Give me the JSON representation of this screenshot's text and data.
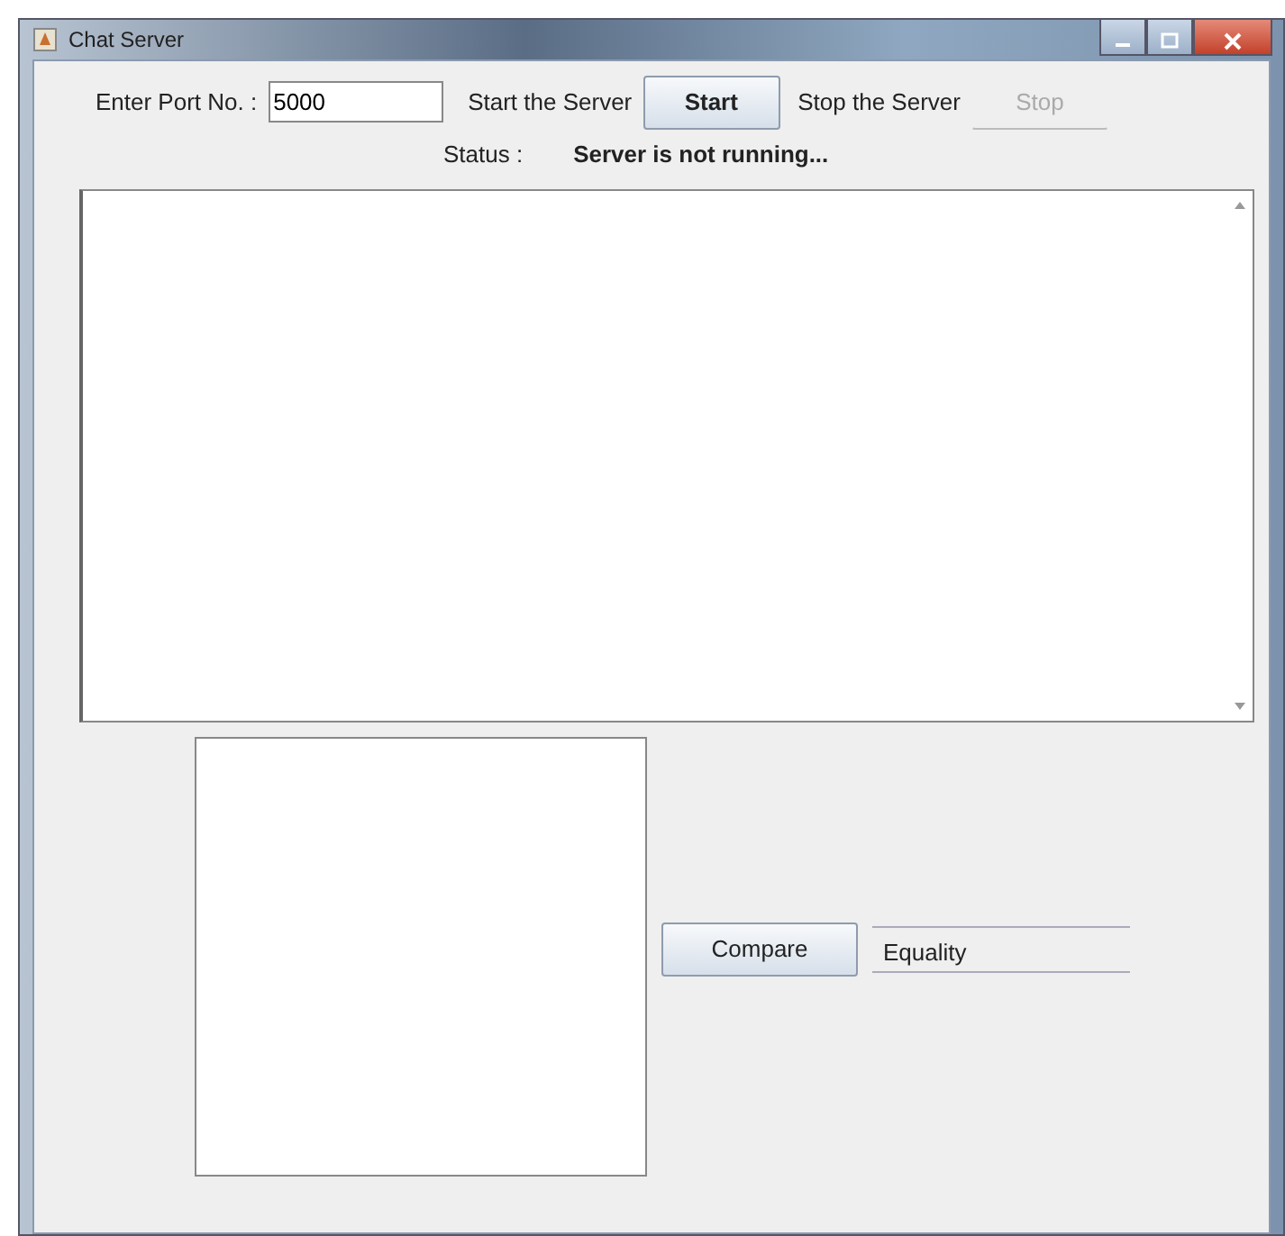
{
  "window": {
    "title": "Chat Server"
  },
  "port": {
    "label": "Enter Port No. :",
    "value": "5000"
  },
  "start": {
    "label": "Start the Server",
    "button": "Start",
    "disabled": false
  },
  "stop": {
    "label": "Stop the Server",
    "button": "Stop",
    "disabled": true
  },
  "status": {
    "label": "Status :",
    "value": "Server is not running..."
  },
  "compare_button": "Compare",
  "result_field": {
    "value": "Equality"
  }
}
